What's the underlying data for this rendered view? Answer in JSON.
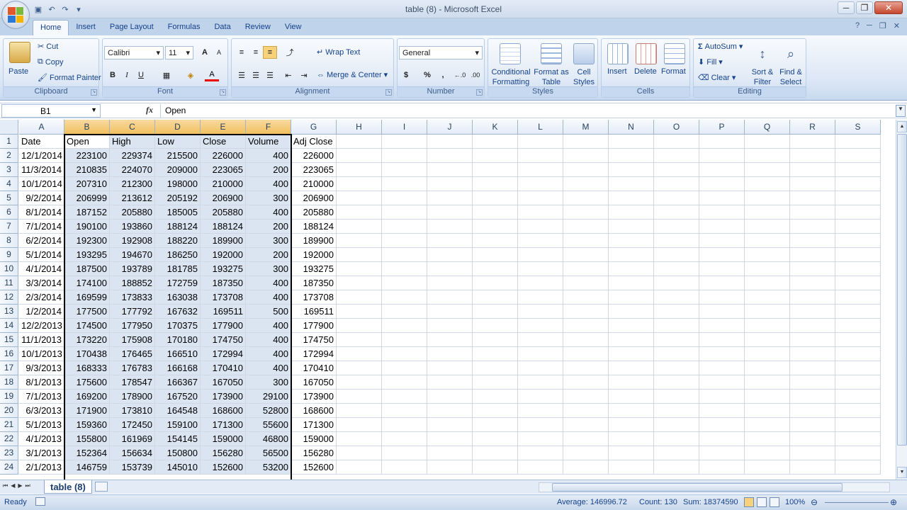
{
  "window": {
    "title": "table (8)  -  Microsoft Excel",
    "min": "─",
    "max": "❐",
    "close": "✕"
  },
  "qat": {
    "save_icon": "save-icon",
    "undo_icon": "undo-icon",
    "redo_icon": "redo-icon"
  },
  "tabs": [
    "Home",
    "Insert",
    "Page Layout",
    "Formulas",
    "Data",
    "Review",
    "View"
  ],
  "active_tab": "Home",
  "ribbon": {
    "clipboard": {
      "label": "Clipboard",
      "paste": "Paste",
      "cut": "Cut",
      "copy": "Copy",
      "format_painter": "Format Painter"
    },
    "font": {
      "label": "Font",
      "family": "Calibri",
      "size": "11",
      "bold": "B",
      "italic": "I",
      "underline": "U",
      "grow": "A",
      "shrink": "A",
      "font_color": "A"
    },
    "alignment": {
      "label": "Alignment",
      "wrap": "Wrap Text",
      "merge": "Merge & Center"
    },
    "number": {
      "label": "Number",
      "format": "General",
      "currency": "$",
      "percent": "%",
      "comma": ",",
      "inc_dec": "←.0",
      "dec_dec": ".00"
    },
    "styles": {
      "label": "Styles",
      "conditional": "Conditional\nFormatting",
      "format_table": "Format as\nTable",
      "cell_styles": "Cell\nStyles"
    },
    "cells": {
      "label": "Cells",
      "insert": "Insert",
      "delete": "Delete",
      "format": "Format"
    },
    "editing": {
      "label": "Editing",
      "autosum": "AutoSum",
      "fill": "Fill",
      "clear": "Clear",
      "sort": "Sort &\nFilter",
      "find": "Find &\nSelect"
    }
  },
  "formula_bar": {
    "name_box": "B1",
    "fx": "fx",
    "content": "Open"
  },
  "columns": [
    "A",
    "B",
    "C",
    "D",
    "E",
    "F",
    "G",
    "H",
    "I",
    "J",
    "K",
    "L",
    "M",
    "N",
    "O",
    "P",
    "Q",
    "R",
    "S"
  ],
  "selected_columns": [
    "B",
    "C",
    "D",
    "E",
    "F"
  ],
  "header_row": [
    "Date",
    "Open",
    "High",
    "Low",
    "Close",
    "Volume",
    "Adj Close"
  ],
  "rows": [
    [
      "12/1/2014",
      "223100",
      "229374",
      "215500",
      "226000",
      "400",
      "226000"
    ],
    [
      "11/3/2014",
      "210835",
      "224070",
      "209000",
      "223065",
      "200",
      "223065"
    ],
    [
      "10/1/2014",
      "207310",
      "212300",
      "198000",
      "210000",
      "400",
      "210000"
    ],
    [
      "9/2/2014",
      "206999",
      "213612",
      "205192",
      "206900",
      "300",
      "206900"
    ],
    [
      "8/1/2014",
      "187152",
      "205880",
      "185005",
      "205880",
      "400",
      "205880"
    ],
    [
      "7/1/2014",
      "190100",
      "193860",
      "188124",
      "188124",
      "200",
      "188124"
    ],
    [
      "6/2/2014",
      "192300",
      "192908",
      "188220",
      "189900",
      "300",
      "189900"
    ],
    [
      "5/1/2014",
      "193295",
      "194670",
      "186250",
      "192000",
      "200",
      "192000"
    ],
    [
      "4/1/2014",
      "187500",
      "193789",
      "181785",
      "193275",
      "300",
      "193275"
    ],
    [
      "3/3/2014",
      "174100",
      "188852",
      "172759",
      "187350",
      "400",
      "187350"
    ],
    [
      "2/3/2014",
      "169599",
      "173833",
      "163038",
      "173708",
      "400",
      "173708"
    ],
    [
      "1/2/2014",
      "177500",
      "177792",
      "167632",
      "169511",
      "500",
      "169511"
    ],
    [
      "12/2/2013",
      "174500",
      "177950",
      "170375",
      "177900",
      "400",
      "177900"
    ],
    [
      "11/1/2013",
      "173220",
      "175908",
      "170180",
      "174750",
      "400",
      "174750"
    ],
    [
      "10/1/2013",
      "170438",
      "176465",
      "166510",
      "172994",
      "400",
      "172994"
    ],
    [
      "9/3/2013",
      "168333",
      "176783",
      "166168",
      "170410",
      "400",
      "170410"
    ],
    [
      "8/1/2013",
      "175600",
      "178547",
      "166367",
      "167050",
      "300",
      "167050"
    ],
    [
      "7/1/2013",
      "169200",
      "178900",
      "167520",
      "173900",
      "29100",
      "173900"
    ],
    [
      "6/3/2013",
      "171900",
      "173810",
      "164548",
      "168600",
      "52800",
      "168600"
    ],
    [
      "5/1/2013",
      "159360",
      "172450",
      "159100",
      "171300",
      "55600",
      "171300"
    ],
    [
      "4/1/2013",
      "155800",
      "161969",
      "154145",
      "159000",
      "46800",
      "159000"
    ],
    [
      "3/1/2013",
      "152364",
      "156634",
      "150800",
      "156280",
      "56500",
      "156280"
    ],
    [
      "2/1/2013",
      "146759",
      "153739",
      "145010",
      "152600",
      "53200",
      "152600"
    ]
  ],
  "sheet_tab": "table (8)",
  "status": {
    "ready": "Ready",
    "average": "Average: 146996.72",
    "count": "Count: 130",
    "sum": "Sum: 18374590",
    "zoom": "100%"
  }
}
